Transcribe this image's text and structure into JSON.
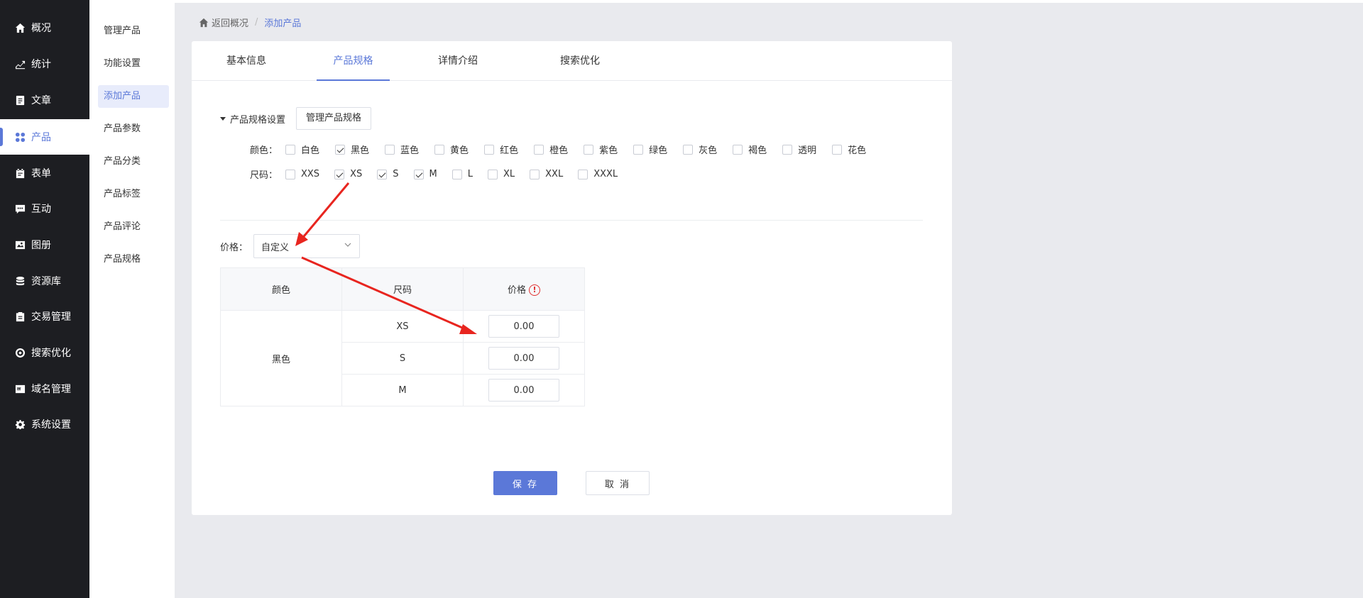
{
  "nav": {
    "items": [
      {
        "label": "概况",
        "icon": "home-icon"
      },
      {
        "label": "统计",
        "icon": "stats-icon"
      },
      {
        "label": "文章",
        "icon": "article-icon"
      },
      {
        "label": "产品",
        "icon": "grid-icon"
      },
      {
        "label": "表单",
        "icon": "form-icon"
      },
      {
        "label": "互动",
        "icon": "chat-icon"
      },
      {
        "label": "图册",
        "icon": "album-icon"
      },
      {
        "label": "资源库",
        "icon": "database-icon"
      },
      {
        "label": "交易管理",
        "icon": "clipboard-icon"
      },
      {
        "label": "搜索优化",
        "icon": "seo-icon"
      },
      {
        "label": "域名管理",
        "icon": "domain-icon"
      },
      {
        "label": "系统设置",
        "icon": "gear-icon"
      }
    ],
    "active": "产品"
  },
  "subnav": {
    "items": [
      "管理产品",
      "功能设置",
      "添加产品",
      "产品参数",
      "产品分类",
      "产品标签",
      "产品评论",
      "产品规格"
    ],
    "active": "添加产品"
  },
  "breadcrumb": {
    "back": "返回概况",
    "separator": "/",
    "current": "添加产品"
  },
  "tabs": [
    "基本信息",
    "产品规格",
    "详情介绍",
    "搜索优化"
  ],
  "active_tab": "产品规格",
  "spec": {
    "section_title": "产品规格设置",
    "manage_button": "管理产品规格",
    "color_label": "颜色：",
    "colors": [
      {
        "label": "白色",
        "checked": false
      },
      {
        "label": "黑色",
        "checked": true
      },
      {
        "label": "蓝色",
        "checked": false
      },
      {
        "label": "黄色",
        "checked": false
      },
      {
        "label": "红色",
        "checked": false
      },
      {
        "label": "橙色",
        "checked": false
      },
      {
        "label": "紫色",
        "checked": false
      },
      {
        "label": "绿色",
        "checked": false
      },
      {
        "label": "灰色",
        "checked": false
      },
      {
        "label": "褐色",
        "checked": false
      },
      {
        "label": "透明",
        "checked": false
      },
      {
        "label": "花色",
        "checked": false
      }
    ],
    "size_label": "尺码：",
    "sizes": [
      {
        "label": "XXS",
        "checked": false
      },
      {
        "label": "XS",
        "checked": true
      },
      {
        "label": "S",
        "checked": true
      },
      {
        "label": "M",
        "checked": true
      },
      {
        "label": "L",
        "checked": false
      },
      {
        "label": "XL",
        "checked": false
      },
      {
        "label": "XXL",
        "checked": false
      },
      {
        "label": "XXXL",
        "checked": false
      }
    ]
  },
  "price": {
    "label": "价格：",
    "mode": "自定义",
    "table": {
      "headers": [
        "颜色",
        "尺码",
        "价格"
      ],
      "warn_symbol": "!",
      "color": "黑色",
      "rows": [
        {
          "size": "XS",
          "price": "0.00"
        },
        {
          "size": "S",
          "price": "0.00"
        },
        {
          "size": "M",
          "price": "0.00"
        }
      ]
    }
  },
  "actions": {
    "save": "保 存",
    "cancel": "取 消"
  },
  "colors": {
    "accent": "#5b78d8",
    "nav_bg": "#1d1e22",
    "annotation": "#e8251f"
  }
}
